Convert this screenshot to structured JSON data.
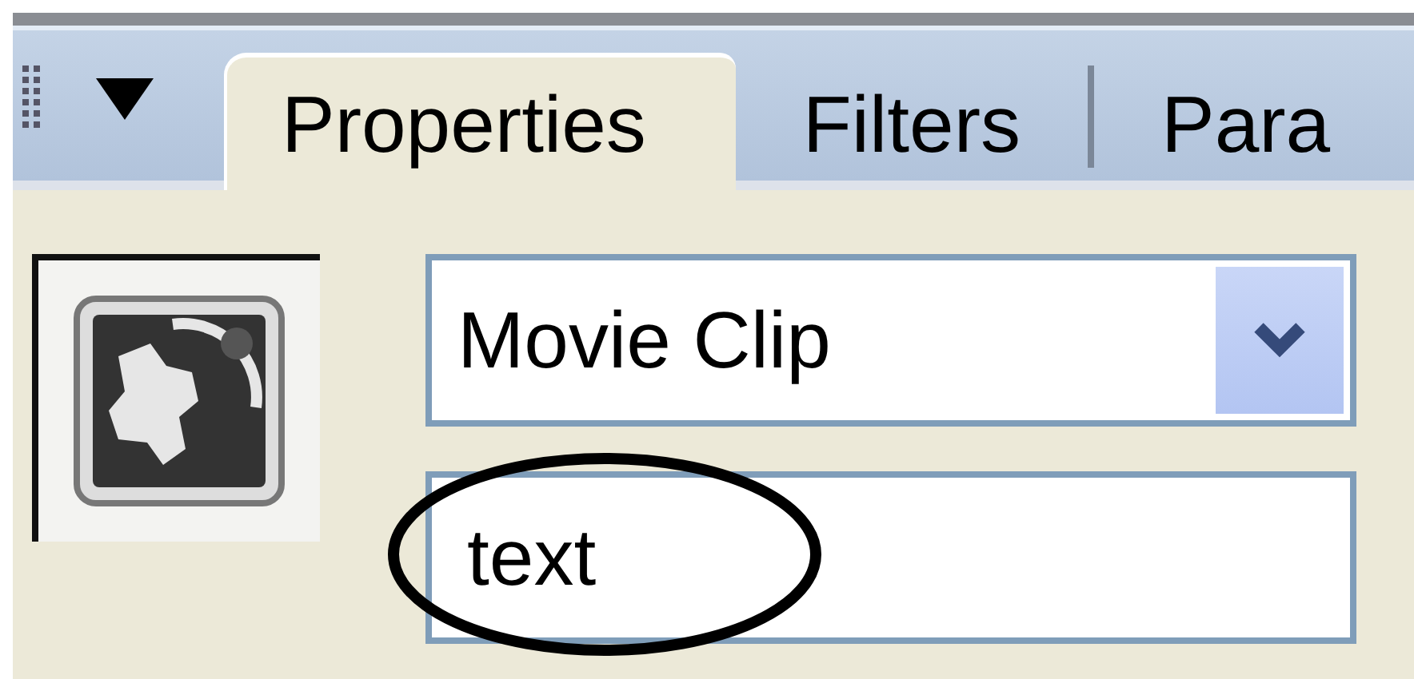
{
  "panel_tabs": [
    {
      "label": "Properties",
      "selected": true
    },
    {
      "label": "Filters",
      "selected": false
    },
    {
      "label": "Para",
      "selected": false
    }
  ],
  "symbol_type": {
    "value": "Movie Clip"
  },
  "instance_name": {
    "value": "text"
  }
}
